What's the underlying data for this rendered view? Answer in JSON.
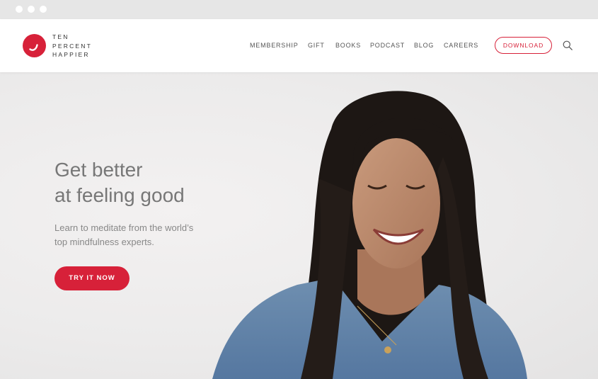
{
  "browser": {
    "dots": [
      "window-dot-1",
      "window-dot-2",
      "window-dot-3"
    ]
  },
  "brand": {
    "name_lines": [
      "TEN",
      "PERCENT",
      "HAPPIER"
    ],
    "color": "#d72139"
  },
  "nav": {
    "items": [
      "MEMBERSHIP",
      "GIFT",
      "BOOKS",
      "PODCAST",
      "BLOG",
      "CAREERS"
    ],
    "download_label": "DOWNLOAD",
    "search_icon": "search-icon"
  },
  "hero": {
    "title_lines": [
      "Get better",
      "at feeling good"
    ],
    "subtitle_lines": [
      "Learn to meditate from the world’s",
      "top mindfulness experts."
    ],
    "cta_label": "TRY IT NOW"
  },
  "colors": {
    "accent": "#d72139",
    "nav_text": "#555555",
    "hero_text": "#777777"
  }
}
